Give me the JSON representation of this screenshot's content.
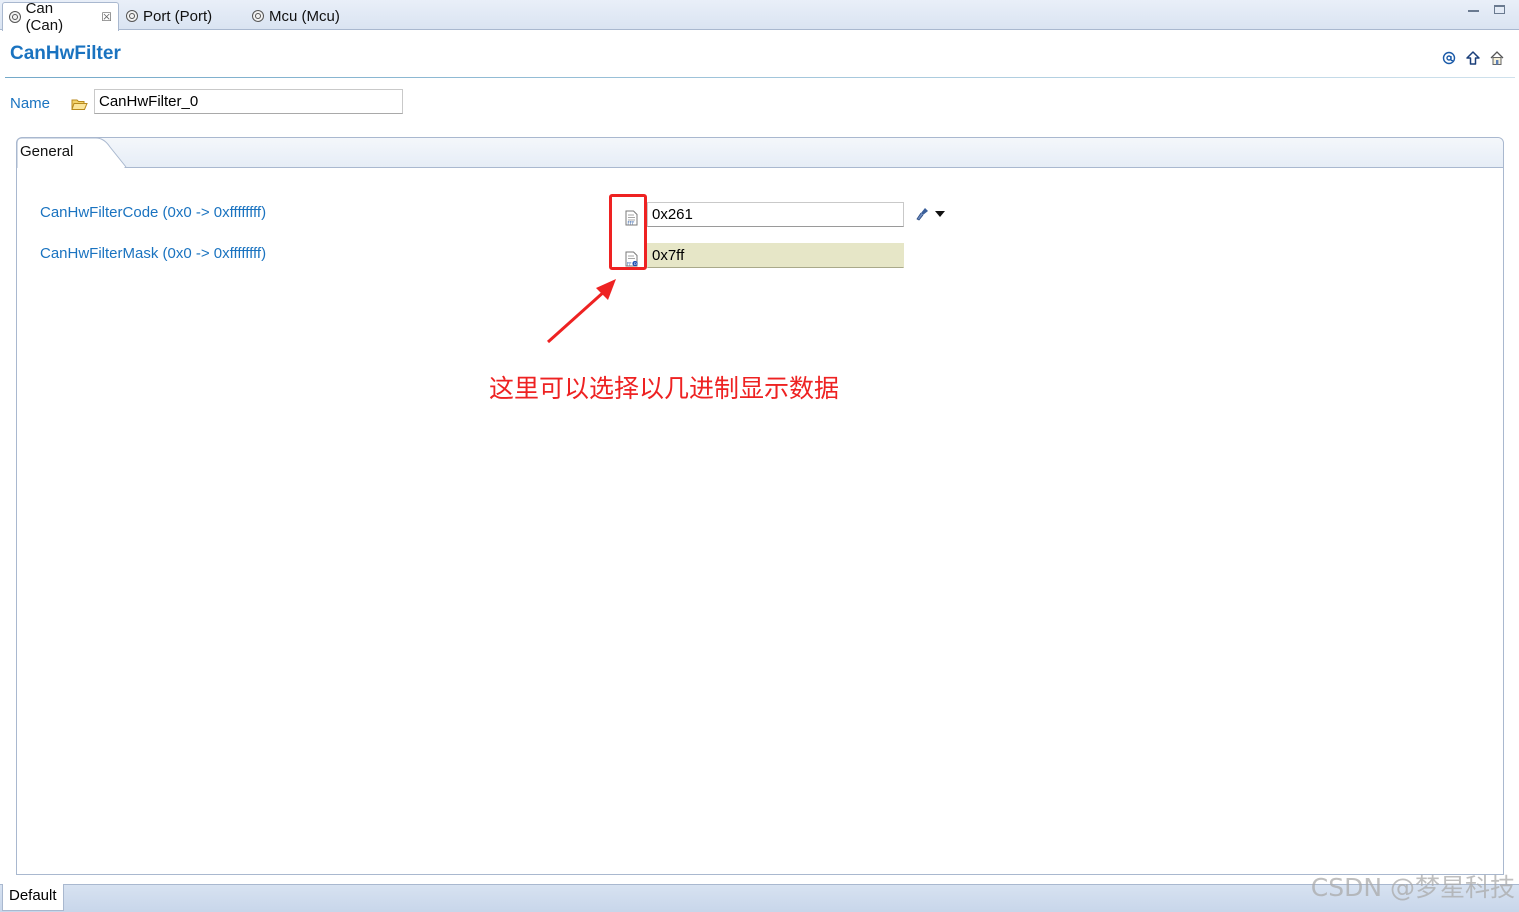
{
  "tabs": [
    {
      "label": "Can (Can)",
      "close": "☒"
    },
    {
      "label": "Port (Port)"
    },
    {
      "label": "Mcu (Mcu)"
    }
  ],
  "header": {
    "title": "CanHwFilter"
  },
  "name_field": {
    "label": "Name",
    "value": "CanHwFilter_0"
  },
  "section": {
    "tab_label": "General"
  },
  "fields": [
    {
      "label": "CanHwFilterCode (0x0 -> 0xffffffff)",
      "value": "0x261",
      "mode_icon": "hex-format-icon"
    },
    {
      "label": "CanHwFilterMask (0x0 -> 0xffffffff)",
      "value": "0x7ff",
      "mode_icon": "hex-format-calculated-icon"
    }
  ],
  "annotation": {
    "text": "这里可以选择以几进制显示数据",
    "color": "#ee2222"
  },
  "bottom": {
    "page_tab": "Default"
  },
  "watermark": "CSDN @梦星科技",
  "colors": {
    "label_blue": "#1a73c0",
    "readonly_bg": "#e6e6c7"
  }
}
